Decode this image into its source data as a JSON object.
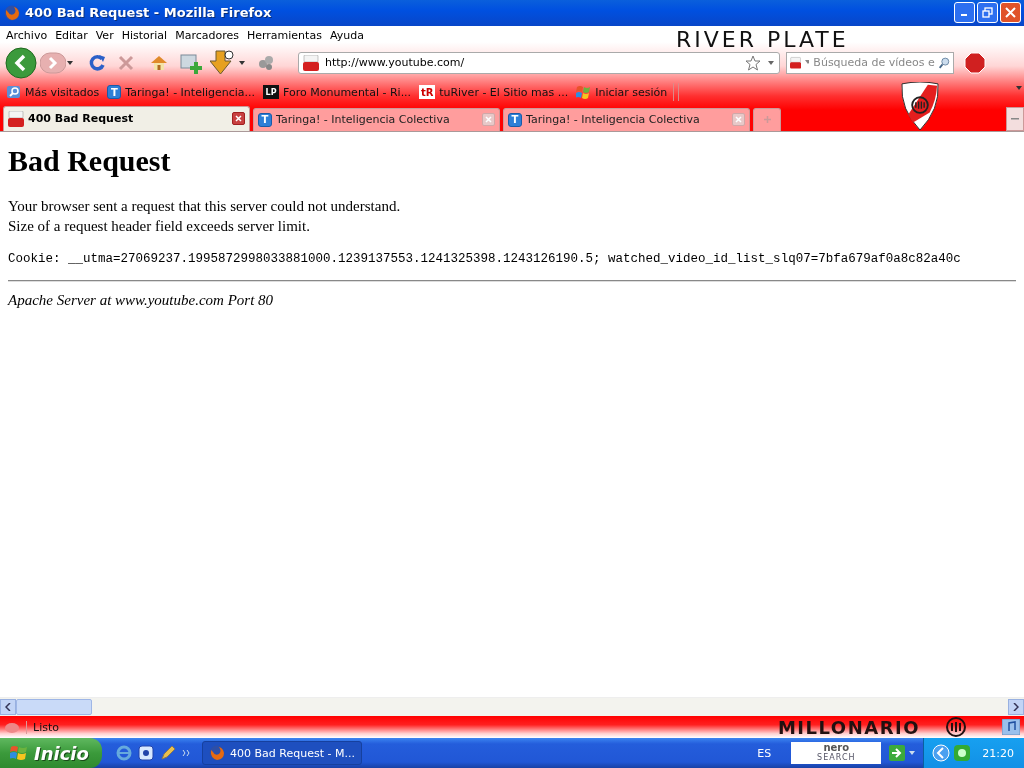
{
  "window": {
    "title": "400 Bad Request - Mozilla Firefox"
  },
  "menu": [
    "Archivo",
    "Editar",
    "Ver",
    "Historial",
    "Marcadores",
    "Herramientas",
    "Ayuda"
  ],
  "theme": {
    "header_text": "RIVER PLATE",
    "footer_text": "MILLONARIO"
  },
  "navigation": {
    "url": "http://www.youtube.com/",
    "search_placeholder": "Búsqueda de vídeos e"
  },
  "bookmarks": [
    {
      "label": "Más visitados",
      "kind": "magnifier"
    },
    {
      "label": "Taringa! - Inteligencia...",
      "kind": "letter",
      "badge": "T"
    },
    {
      "label": "Foro Monumental - Ri...",
      "kind": "dark",
      "badge": "LP"
    },
    {
      "label": "tuRiver - El Sitio mas ...",
      "kind": "light",
      "badge": "tR"
    },
    {
      "label": "Iniciar sesión",
      "kind": "windows"
    }
  ],
  "tabs": [
    {
      "label": "400 Bad Request",
      "selected": true,
      "kind": "video"
    },
    {
      "label": "Taringa! - Inteligencia Colectiva",
      "selected": false,
      "kind": "letter",
      "badge": "T"
    },
    {
      "label": "Taringa! - Inteligencia Colectiva",
      "selected": false,
      "kind": "letter",
      "badge": "T"
    }
  ],
  "page": {
    "heading": "Bad Request",
    "lines": [
      "Your browser sent a request that this server could not understand.",
      "Size of a request header field exceeds server limit."
    ],
    "code": "Cookie: __utma=27069237.1995872998033881000.1239137553.1241325398.1243126190.5; watched_video_id_list_slq07=7bfa679af0a8c82a40c",
    "address": "Apache Server at www.youtube.com Port 80"
  },
  "status_bar": {
    "text": "Listo"
  },
  "taskbar": {
    "start": "Inicio",
    "task": "400 Bad Request - M...",
    "language": "ES",
    "nero_search": [
      "nero",
      "SEARCH"
    ],
    "clock": "21:20"
  }
}
